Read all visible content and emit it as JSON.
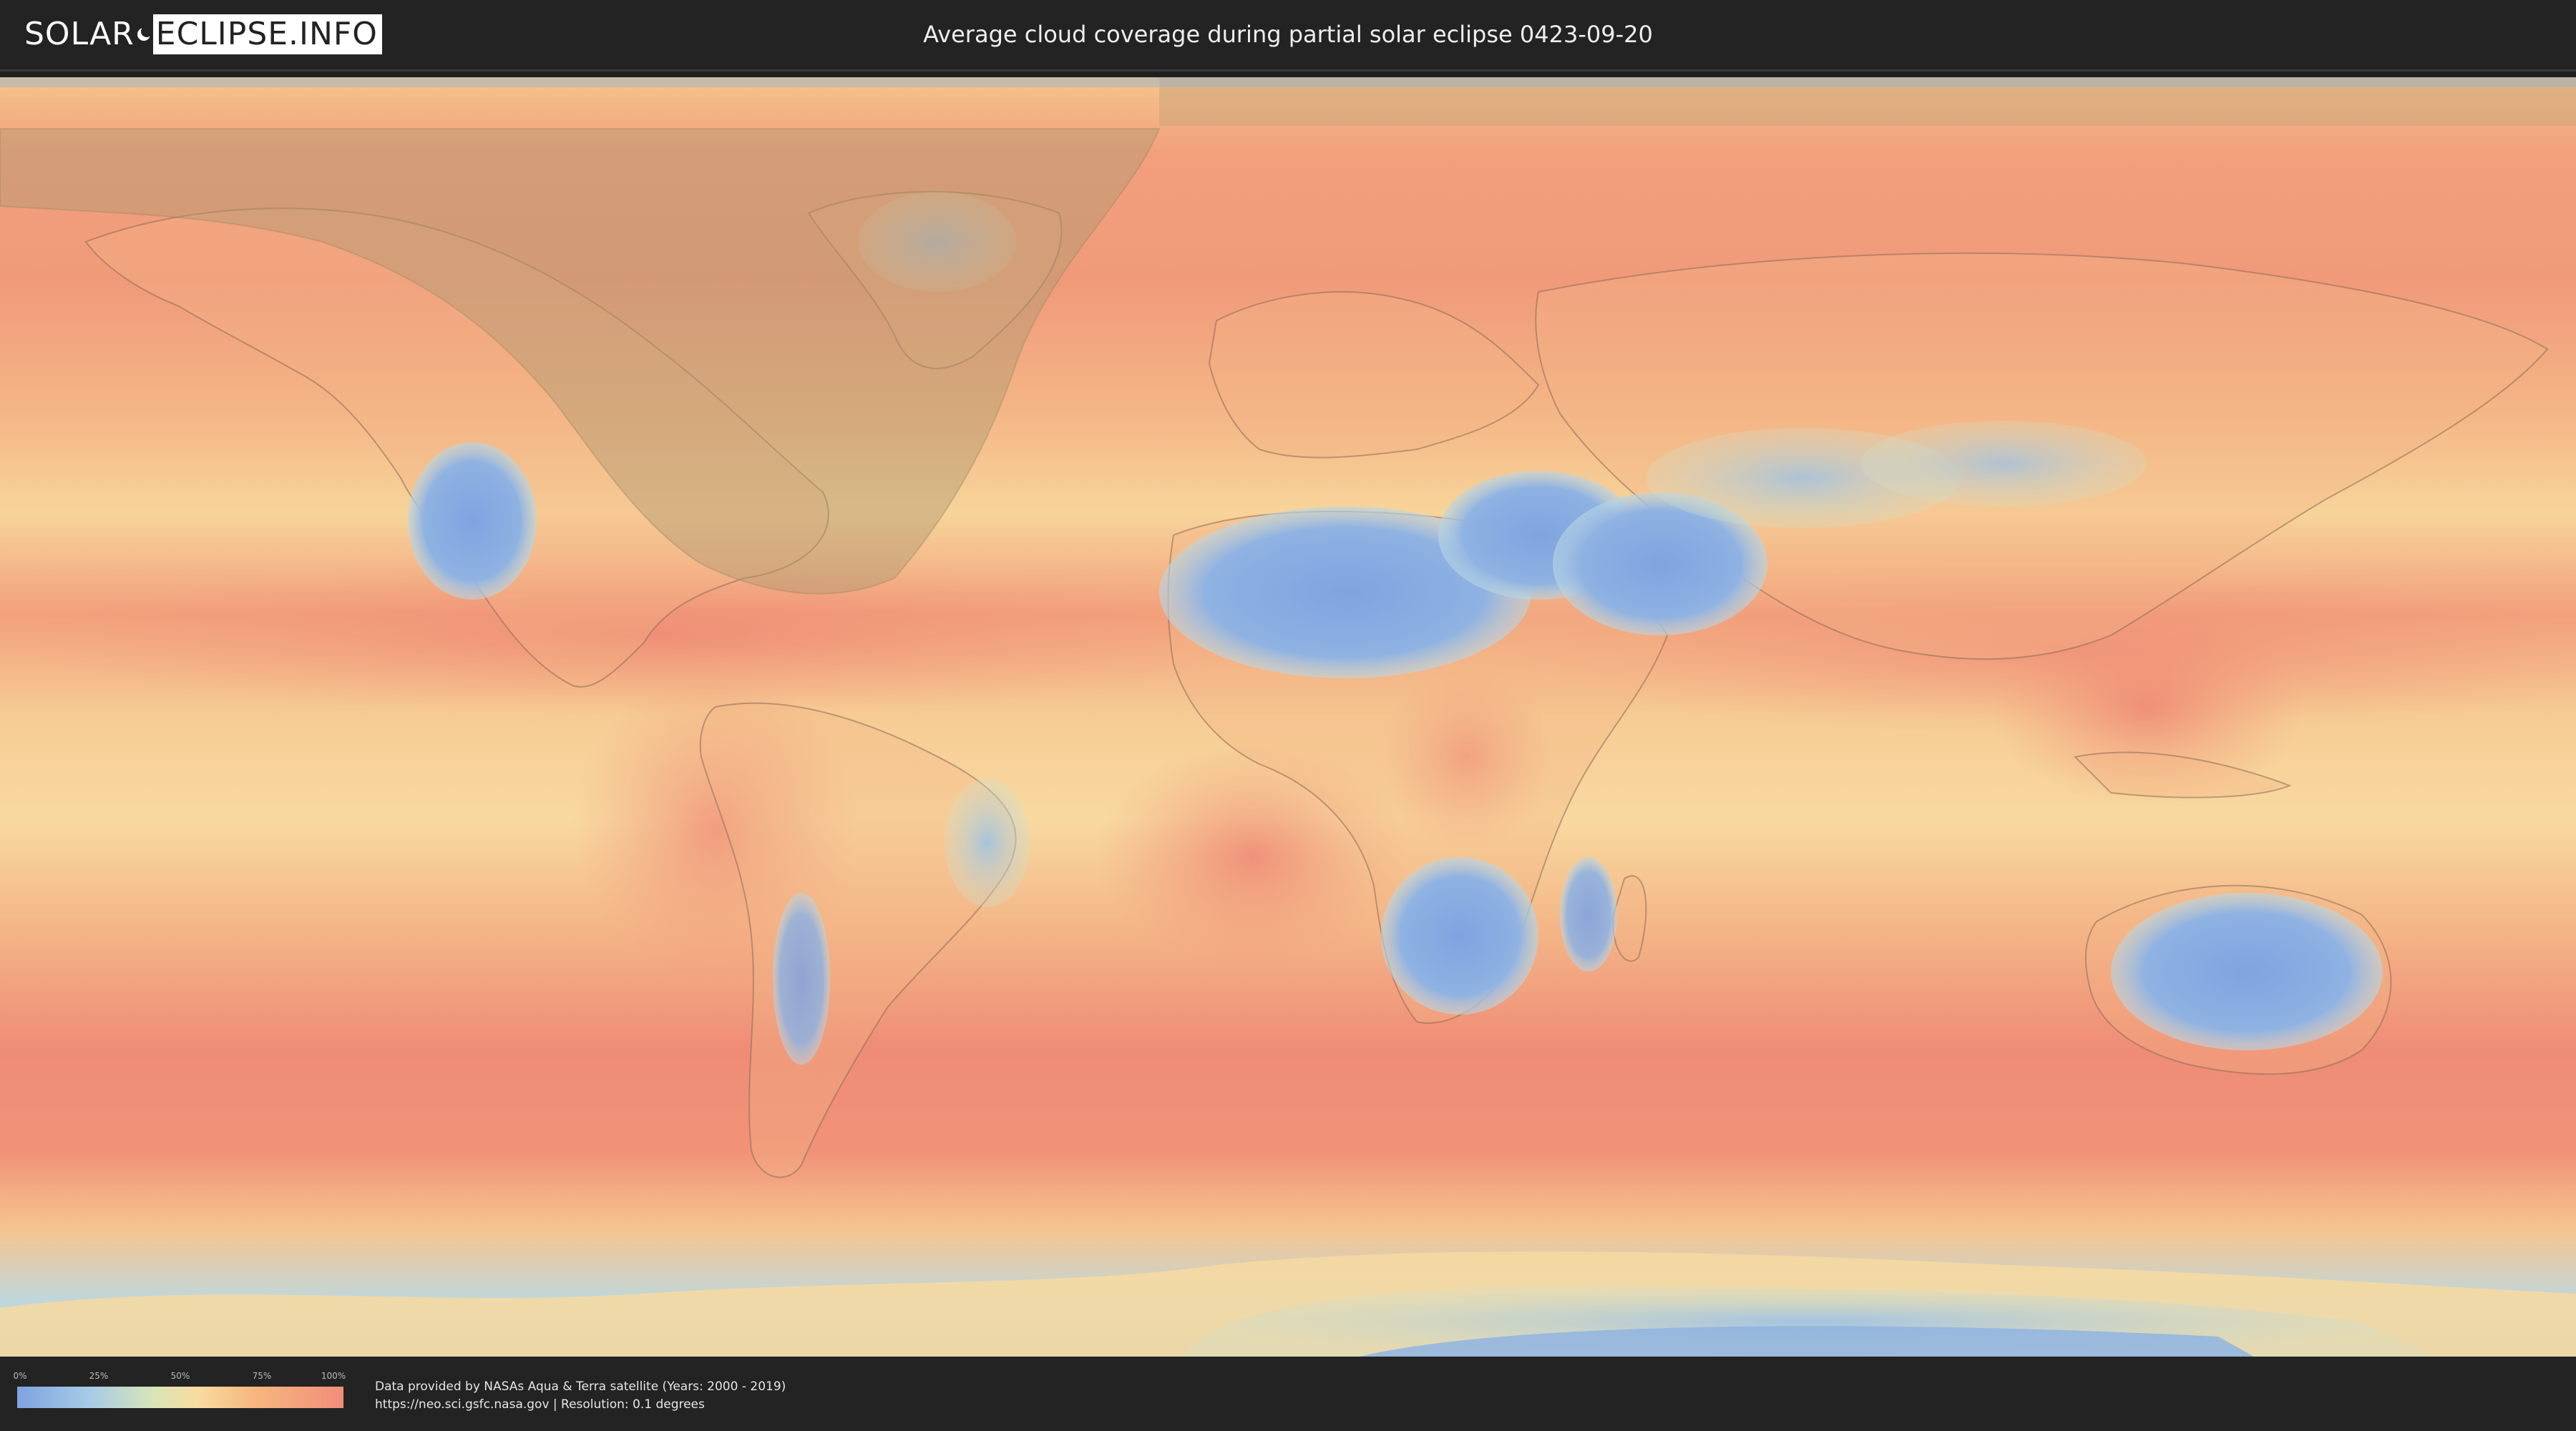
{
  "header": {
    "logo_left": "SOLAR",
    "logo_right": "ECLIPSE.INFO",
    "title": "Average cloud coverage during partial solar eclipse 0423-09-20"
  },
  "map": {
    "description_layer": "cloud-coverage",
    "eclipse_visibility_shading": "partial-eclipse-zone"
  },
  "legend": {
    "ticks": [
      "0%",
      "25%",
      "50%",
      "75%",
      "100%"
    ],
    "colors": [
      "#7ea3e0",
      "#a6cbe6",
      "#f8dca0",
      "#f6b880",
      "#f28d78"
    ]
  },
  "footer": {
    "credit_line1": "Data provided by NASAs Aqua & Terra satellite (Years: 2000 - 2019)",
    "credit_line2": "https://neo.sci.gsfc.nasa.gov | Resolution: 0.1 degrees"
  }
}
